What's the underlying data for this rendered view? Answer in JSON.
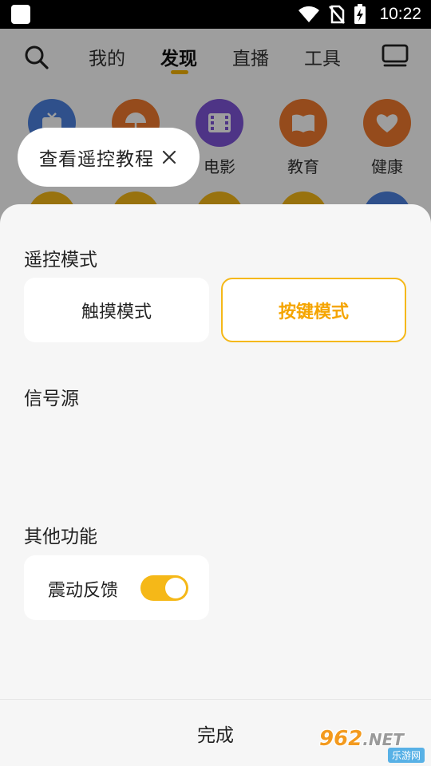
{
  "status_bar": {
    "time": "10:22",
    "icons": [
      "wifi-icon",
      "no-sim-icon",
      "battery-charging-icon"
    ]
  },
  "top_nav": {
    "tabs": [
      {
        "label": "我的",
        "active": false
      },
      {
        "label": "发现",
        "active": true
      },
      {
        "label": "直播",
        "active": false
      },
      {
        "label": "工具",
        "active": false
      }
    ],
    "icons": [
      "search-icon",
      "tv-icon"
    ],
    "accent_color": "#f5b400"
  },
  "categories": {
    "row1": [
      {
        "label": "",
        "icon": "tv-icon",
        "color": "#4c82e0"
      },
      {
        "label": "",
        "icon": "umbrella-icon",
        "color": "#f07a2e"
      },
      {
        "label": "电影",
        "icon": "film-icon",
        "color": "#7e55d8"
      },
      {
        "label": "教育",
        "icon": "book-icon",
        "color": "#f07a2e"
      },
      {
        "label": "健康",
        "icon": "heart-icon",
        "color": "#f07a2e"
      }
    ],
    "row2_colors": [
      "#f5b818",
      "#f5b818",
      "#f5b818",
      "#f5b818",
      "#4c82e0"
    ]
  },
  "tooltip": {
    "text": "查看遥控教程",
    "close_icon": "close-icon"
  },
  "sheet": {
    "remote_mode": {
      "title": "遥控模式",
      "options": [
        {
          "label": "触摸模式",
          "selected": false
        },
        {
          "label": "按键模式",
          "selected": true
        }
      ]
    },
    "signal_source": {
      "title": "信号源"
    },
    "other_features": {
      "title": "其他功能",
      "vibration": {
        "label": "震动反馈",
        "on": true
      }
    },
    "done_label": "完成",
    "accent_color": "#f5b818"
  },
  "watermark": {
    "brand": "962",
    "domain": ".NET",
    "sub": "乐游网"
  }
}
